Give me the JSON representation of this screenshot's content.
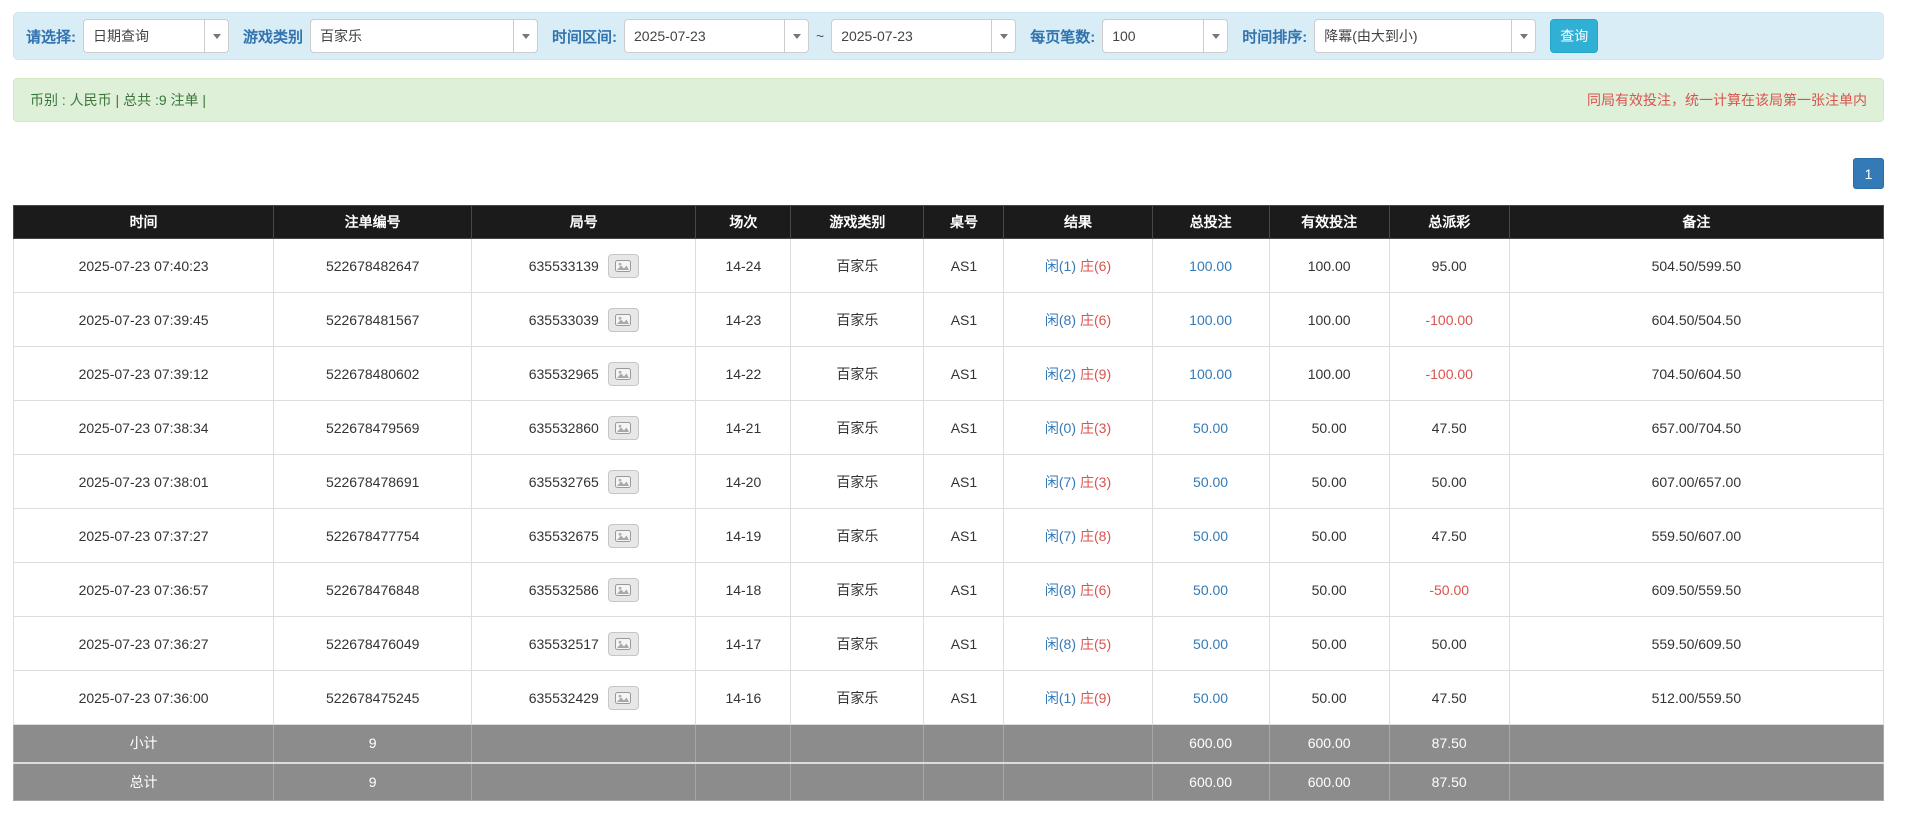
{
  "filters": {
    "select_label": "请选择:",
    "select_value": "日期查询",
    "game_label": "游戏类别",
    "game_value": "百家乐",
    "range_label": "时间区间:",
    "date_from": "2025-07-23",
    "tilde": "~",
    "date_to": "2025-07-23",
    "per_page_label": "每页笔数:",
    "per_page_value": "100",
    "sort_label": "时间排序:",
    "sort_value": "降冪(由大到小)",
    "search_button": "查询"
  },
  "summary": {
    "left": "币别 : 人民币 | 总共 :9 注单 |",
    "right": "同局有效投注，统一计算在该局第一张注单内"
  },
  "pagination": {
    "current": "1"
  },
  "colors": {
    "accent_blue": "#337ab7",
    "player_blue": "#337ab7",
    "banker_red": "#d9534f",
    "negative_red": "#d9534f",
    "header_bg": "#1b1b1b",
    "footer_bg": "#8c8c8c",
    "filter_bar_bg": "#d9edf7",
    "summary_bar_bg": "#dff0d8",
    "search_button_bg": "#31b0d5"
  },
  "table": {
    "headers": [
      "时间",
      "注单编号",
      "局号",
      "场次",
      "游戏类别",
      "桌号",
      "结果",
      "总投注",
      "有效投注",
      "总派彩",
      "备注"
    ],
    "rows": [
      {
        "time": "2025-07-23 07:40:23",
        "bet_id": "522678482647",
        "round": "635533139",
        "session": "14-24",
        "game": "百家乐",
        "table_no": "AS1",
        "player": "闲(1)",
        "banker": "庄(6)",
        "total_bet": "100.00",
        "valid_bet": "100.00",
        "payout": "95.00",
        "remark": "504.50/599.50"
      },
      {
        "time": "2025-07-23 07:39:45",
        "bet_id": "522678481567",
        "round": "635533039",
        "session": "14-23",
        "game": "百家乐",
        "table_no": "AS1",
        "player": "闲(8)",
        "banker": "庄(6)",
        "total_bet": "100.00",
        "valid_bet": "100.00",
        "payout": "-100.00",
        "remark": "604.50/504.50"
      },
      {
        "time": "2025-07-23 07:39:12",
        "bet_id": "522678480602",
        "round": "635532965",
        "session": "14-22",
        "game": "百家乐",
        "table_no": "AS1",
        "player": "闲(2)",
        "banker": "庄(9)",
        "total_bet": "100.00",
        "valid_bet": "100.00",
        "payout": "-100.00",
        "remark": "704.50/604.50"
      },
      {
        "time": "2025-07-23 07:38:34",
        "bet_id": "522678479569",
        "round": "635532860",
        "session": "14-21",
        "game": "百家乐",
        "table_no": "AS1",
        "player": "闲(0)",
        "banker": "庄(3)",
        "total_bet": "50.00",
        "valid_bet": "50.00",
        "payout": "47.50",
        "remark": "657.00/704.50"
      },
      {
        "time": "2025-07-23 07:38:01",
        "bet_id": "522678478691",
        "round": "635532765",
        "session": "14-20",
        "game": "百家乐",
        "table_no": "AS1",
        "player": "闲(7)",
        "banker": "庄(3)",
        "total_bet": "50.00",
        "valid_bet": "50.00",
        "payout": "50.00",
        "remark": "607.00/657.00"
      },
      {
        "time": "2025-07-23 07:37:27",
        "bet_id": "522678477754",
        "round": "635532675",
        "session": "14-19",
        "game": "百家乐",
        "table_no": "AS1",
        "player": "闲(7)",
        "banker": "庄(8)",
        "total_bet": "50.00",
        "valid_bet": "50.00",
        "payout": "47.50",
        "remark": "559.50/607.00"
      },
      {
        "time": "2025-07-23 07:36:57",
        "bet_id": "522678476848",
        "round": "635532586",
        "session": "14-18",
        "game": "百家乐",
        "table_no": "AS1",
        "player": "闲(8)",
        "banker": "庄(6)",
        "total_bet": "50.00",
        "valid_bet": "50.00",
        "payout": "-50.00",
        "remark": "609.50/559.50"
      },
      {
        "time": "2025-07-23 07:36:27",
        "bet_id": "522678476049",
        "round": "635532517",
        "session": "14-17",
        "game": "百家乐",
        "table_no": "AS1",
        "player": "闲(8)",
        "banker": "庄(5)",
        "total_bet": "50.00",
        "valid_bet": "50.00",
        "payout": "50.00",
        "remark": "559.50/609.50"
      },
      {
        "time": "2025-07-23 07:36:00",
        "bet_id": "522678475245",
        "round": "635532429",
        "session": "14-16",
        "game": "百家乐",
        "table_no": "AS1",
        "player": "闲(1)",
        "banker": "庄(9)",
        "total_bet": "50.00",
        "valid_bet": "50.00",
        "payout": "47.50",
        "remark": "512.00/559.50"
      }
    ],
    "footer_rows": [
      {
        "label": "小计",
        "count": "9",
        "total_bet": "600.00",
        "valid_bet": "600.00",
        "payout": "87.50"
      },
      {
        "label": "总计",
        "count": "9",
        "total_bet": "600.00",
        "valid_bet": "600.00",
        "payout": "87.50"
      }
    ]
  }
}
